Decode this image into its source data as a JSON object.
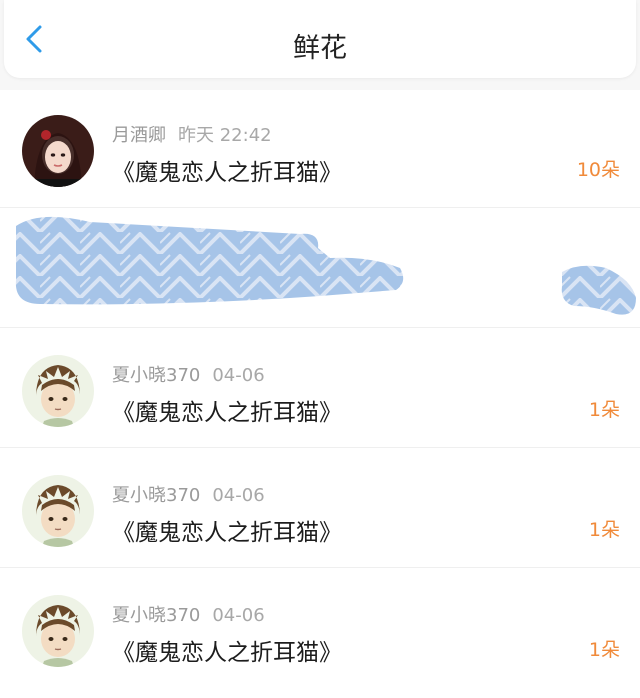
{
  "header": {
    "title": "鲜花",
    "back_icon": "chevron-left-icon",
    "accent_color": "#2f9be9"
  },
  "list": [
    {
      "name": "月酒卿",
      "time": "昨天 22:42",
      "book": "《魔鬼恋人之折耳猫》",
      "count": "10朵"
    },
    {
      "redacted": true
    },
    {
      "name": "夏小晓370",
      "time": "04-06",
      "book": "《魔鬼恋人之折耳猫》",
      "count": "1朵"
    },
    {
      "name": "夏小晓370",
      "time": "04-06",
      "book": "《魔鬼恋人之折耳猫》",
      "count": "1朵"
    },
    {
      "name": "夏小晓370",
      "time": "04-06",
      "book": "《魔鬼恋人之折耳猫》",
      "count": "1朵"
    }
  ],
  "count_color": "#f08a3a"
}
